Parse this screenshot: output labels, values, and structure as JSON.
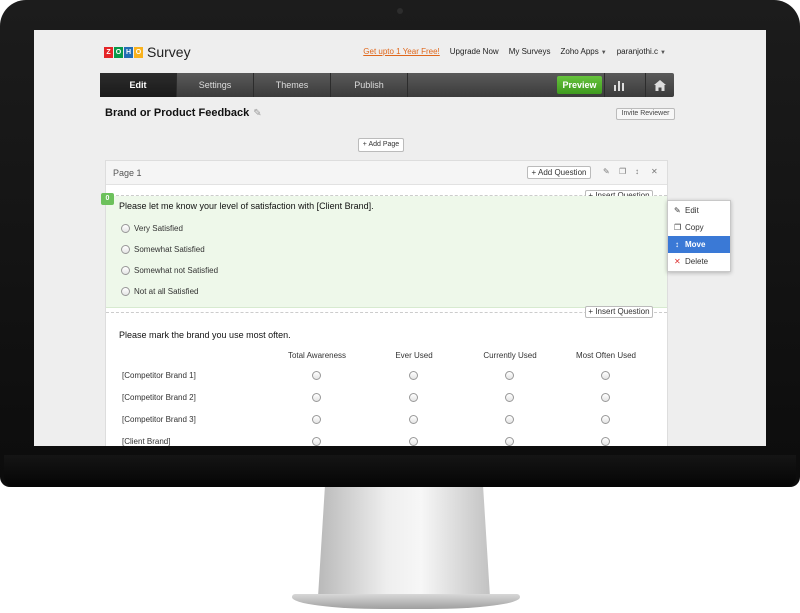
{
  "app": {
    "logo_letters": [
      "Z",
      "O",
      "H",
      "O"
    ],
    "logo_text": "Survey"
  },
  "top_links": {
    "promo": "Get upto 1 Year Free!",
    "upgrade": "Upgrade Now",
    "my_surveys": "My Surveys",
    "zoho_apps": "Zoho Apps",
    "user": "paranjothi.c"
  },
  "nav": {
    "tabs": [
      "Edit",
      "Settings",
      "Themes",
      "Publish"
    ],
    "active_tab": "Edit",
    "preview": "Preview",
    "icons": [
      "bar-chart-icon",
      "home-icon"
    ]
  },
  "survey": {
    "title": "Brand or Product Feedback",
    "invite": "Invite Reviewer",
    "add_page": "+ Add Page"
  },
  "page": {
    "label": "Page 1",
    "add_question": "+ Add Question",
    "insert_question": "+ Insert Question"
  },
  "question1": {
    "number": "0",
    "text": "Please let me know your level of satisfaction with [Client Brand].",
    "options": [
      "Very Satisfied",
      "Somewhat Satisfied",
      "Somewhat not Satisfied",
      "Not at all Satisfied"
    ]
  },
  "question2": {
    "text": "Please mark the brand you use most often.",
    "columns": [
      "Total Awareness",
      "Ever Used",
      "Currently Used",
      "Most Often Used"
    ],
    "rows": [
      "[Competitor Brand 1]",
      "[Competitor Brand 2]",
      "[Competitor Brand 3]",
      "[Client Brand]"
    ]
  },
  "context_menu": {
    "items": [
      "Edit",
      "Copy",
      "Move",
      "Delete"
    ],
    "active": "Move"
  },
  "colors": {
    "accent_green": "#4caf2a",
    "menu_highlight": "#3a79d6",
    "question_bg": "#eef8ea"
  }
}
